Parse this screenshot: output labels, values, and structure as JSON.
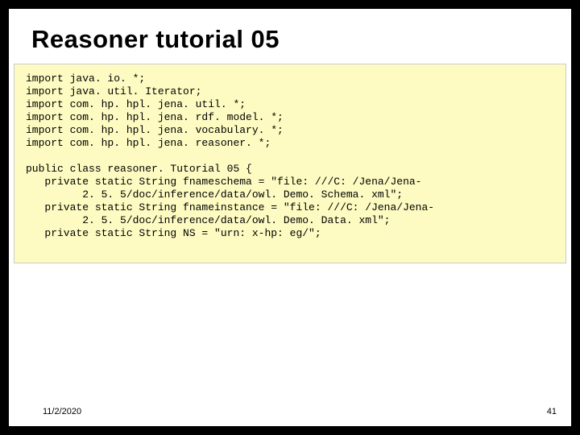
{
  "title": "Reasoner tutorial 05",
  "code": {
    "imports": [
      "import java. io. *;",
      "import java. util. Iterator;",
      "import com. hp. hpl. jena. util. *;",
      "import com. hp. hpl. jena. rdf. model. *;",
      "import com. hp. hpl. jena. vocabulary. *;",
      "import com. hp. hpl. jena. reasoner. *;"
    ],
    "body": [
      "public class reasoner. Tutorial 05 {",
      "   private static String fnameschema = \"file: ///C: /Jena/Jena-",
      "         2. 5. 5/doc/inference/data/owl. Demo. Schema. xml\";",
      "   private static String fnameinstance = \"file: ///C: /Jena/Jena-",
      "         2. 5. 5/doc/inference/data/owl. Demo. Data. xml\";",
      "   private static String NS = \"urn: x-hp: eg/\";"
    ]
  },
  "footer": {
    "date": "11/2/2020",
    "page": "41"
  }
}
